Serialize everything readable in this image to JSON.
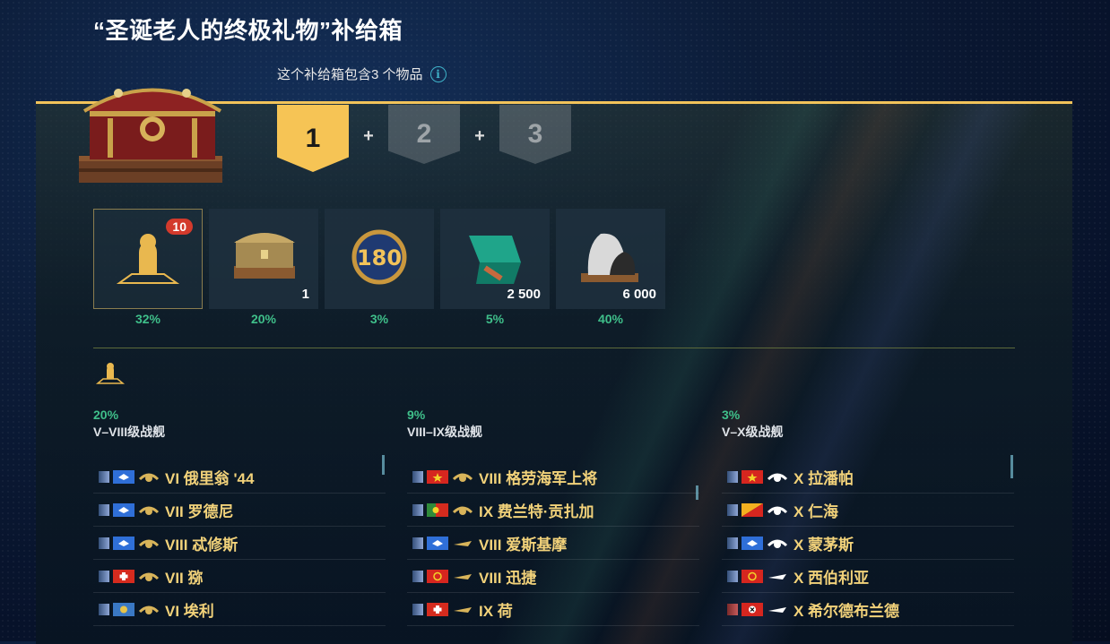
{
  "title": "“圣诞老人的终极礼物”补给箱",
  "subtitle": "这个补给箱包含3 个物品",
  "info_icon": "info-icon",
  "steps": [
    "1",
    "2",
    "3"
  ],
  "step_separator": "+",
  "items": [
    {
      "name": "ship-silhouette",
      "badge": "10",
      "qty": "",
      "percent": "32%"
    },
    {
      "name": "santa-container",
      "badge": "",
      "qty": "1",
      "percent": "20%"
    },
    {
      "name": "180-emblem",
      "badge": "",
      "qty": "",
      "percent": "3%"
    },
    {
      "name": "camouflage-pack",
      "badge": "",
      "qty": "2 500",
      "percent": "5%"
    },
    {
      "name": "coal-bags",
      "badge": "",
      "qty": "6 000",
      "percent": "40%"
    }
  ],
  "columns": [
    {
      "percent": "20%",
      "range": "V–VIII级战舰",
      "ships": [
        {
          "nation": "uk",
          "label": "VI 俄里翁 '44"
        },
        {
          "nation": "uk",
          "label": "VII 罗德尼"
        },
        {
          "nation": "uk",
          "label": "VIII 忒修斯"
        },
        {
          "nation": "switzerland",
          "label": "VII 猕"
        },
        {
          "nation": "commonwealth",
          "label": "VI 埃利"
        }
      ]
    },
    {
      "percent": "9%",
      "range": "VIII–IX级战舰",
      "ships": [
        {
          "nation": "vietnam",
          "label": "VIII 格劳海军上将"
        },
        {
          "nation": "portugal",
          "label": "IX 费兰特·贡扎加"
        },
        {
          "nation": "uk",
          "label": "VIII 爱斯基摩"
        },
        {
          "nation": "china",
          "label": "VIII 迅捷"
        },
        {
          "nation": "switzerland",
          "label": "IX 荷"
        }
      ]
    },
    {
      "percent": "3%",
      "range": "V–X级战舰",
      "ships": [
        {
          "nation": "vietnam",
          "label": "X 拉潘帕"
        },
        {
          "nation": "bhutan",
          "label": "X 仁海"
        },
        {
          "nation": "uk",
          "label": "X 蒙茅斯"
        },
        {
          "nation": "china",
          "label": "X 西伯利亚"
        },
        {
          "nation": "germany",
          "label": "X 希尔德布兰德"
        }
      ]
    }
  ],
  "colors": {
    "accent": "#f6c455",
    "percent": "#3fbf8a",
    "ship_name": "#f2d27a"
  }
}
